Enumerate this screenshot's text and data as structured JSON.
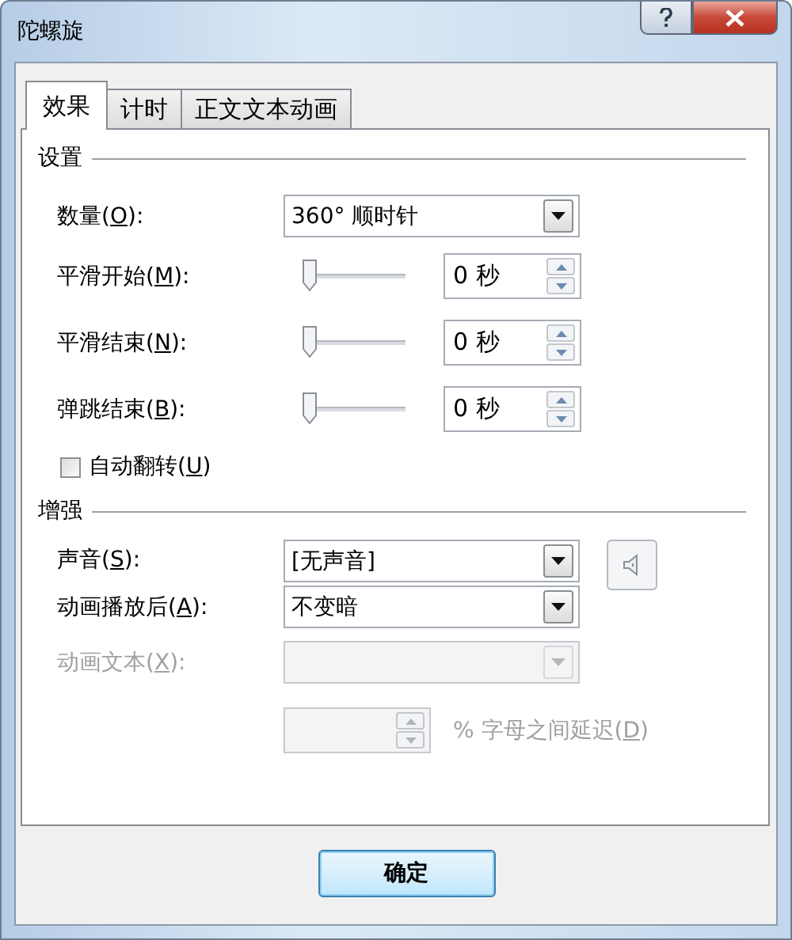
{
  "window": {
    "title": "陀螺旋"
  },
  "tabs": [
    {
      "label": "效果",
      "selected": true
    },
    {
      "label": "计时",
      "selected": false
    },
    {
      "label": "正文文本动画",
      "selected": false
    }
  ],
  "settings": {
    "heading": "设置",
    "amount": {
      "label_parts": [
        "数量(",
        "O",
        "):"
      ],
      "value": "360° 顺时针",
      "disabled": false
    },
    "sliders": [
      {
        "label_parts": [
          "平滑开始(",
          "M",
          "):"
        ],
        "level": 0,
        "value": "0 秒"
      },
      {
        "label_parts": [
          "平滑结束(",
          "N",
          "):"
        ],
        "level": 0,
        "value": "0 秒"
      },
      {
        "label_parts": [
          "弹跳结束(",
          "B",
          "):"
        ],
        "level": 0,
        "value": "0 秒"
      }
    ],
    "auto_reverse": {
      "label_parts": [
        "自动翻转(",
        "U",
        ")"
      ],
      "checked": false
    }
  },
  "enhancements": {
    "heading": "增强",
    "sound": {
      "label_parts": [
        "声音(",
        "S",
        "):"
      ],
      "value": "[无声音]",
      "disabled": false
    },
    "after_animation": {
      "label_parts": [
        "动画播放后(",
        "A",
        "):"
      ],
      "value": "不变暗",
      "disabled": false
    },
    "animate_text": {
      "label_parts": [
        "动画文本(",
        "X",
        "):"
      ],
      "disabled": true
    },
    "delay": {
      "label_parts": [
        "% 字母之间延迟(",
        "D",
        ")"
      ],
      "disabled": true
    }
  },
  "buttons": [
    {
      "label": "确定"
    }
  ]
}
